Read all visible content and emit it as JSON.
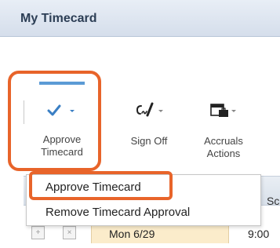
{
  "window": {
    "title": "My Timecard"
  },
  "toolbar": {
    "approve": {
      "label": "Approve\nTimecard",
      "icon": "check-icon"
    },
    "signoff": {
      "label": "Sign Off",
      "icon": "signature-icon"
    },
    "accruals": {
      "label": "Accruals\nActions",
      "icon": "calendar-briefcase-icon"
    }
  },
  "menu": {
    "items": [
      "Approve Timecard",
      "Remove Timecard Approval"
    ]
  },
  "grid": {
    "header_partial": "Sc",
    "row": {
      "date": "Mon 6/29",
      "time": "9:00"
    }
  },
  "colors": {
    "highlight": "#e8642a",
    "accent": "#5b9bd5",
    "row_date_bg": "#fbeccb"
  }
}
